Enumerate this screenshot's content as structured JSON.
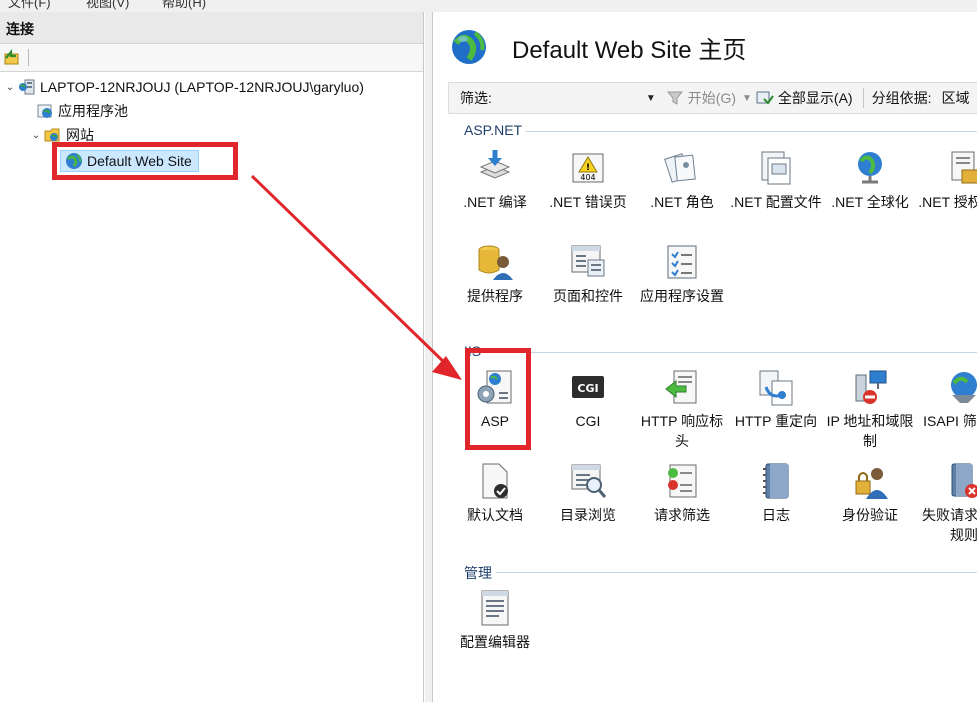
{
  "menubar": {
    "items": [
      "文件(F)",
      "视图(V)",
      "帮助(H)"
    ]
  },
  "connections": {
    "header": "连接",
    "tree": {
      "server": "LAPTOP-12NRJOUJ (LAPTOP-12NRJOUJ\\garyluo)",
      "app_pools": "应用程序池",
      "sites": "网站",
      "default_site": "Default Web Site"
    }
  },
  "main": {
    "title": "Default Web Site 主页",
    "filterbar": {
      "filter_label": "筛选:",
      "start": "开始(G)",
      "show_all": "全部显示(A)",
      "group_by": "分组依据:",
      "group_value": "区域"
    },
    "sections": {
      "aspnet": {
        "label": "ASP.NET",
        "features": [
          ".NET 编译",
          ".NET 错误页",
          ".NET 角色",
          ".NET 配置文件",
          ".NET 全球化",
          ".NET 授权规则",
          "提供程序",
          "页面和控件",
          "应用程序设置"
        ]
      },
      "iis": {
        "label": "IIS",
        "features": [
          "ASP",
          "CGI",
          "HTTP 响应标头",
          "HTTP 重定向",
          "IP 地址和域限制",
          "ISAPI 筛选器",
          "默认文档",
          "目录浏览",
          "请求筛选",
          "日志",
          "身份验证",
          "失败请求跟踪规则"
        ]
      },
      "management": {
        "label": "管理",
        "features": [
          "配置编辑器"
        ]
      }
    }
  },
  "colors": {
    "highlight_red": "#e0262b",
    "selection": "#cce8ff",
    "section_text": "#1f3f6a"
  }
}
